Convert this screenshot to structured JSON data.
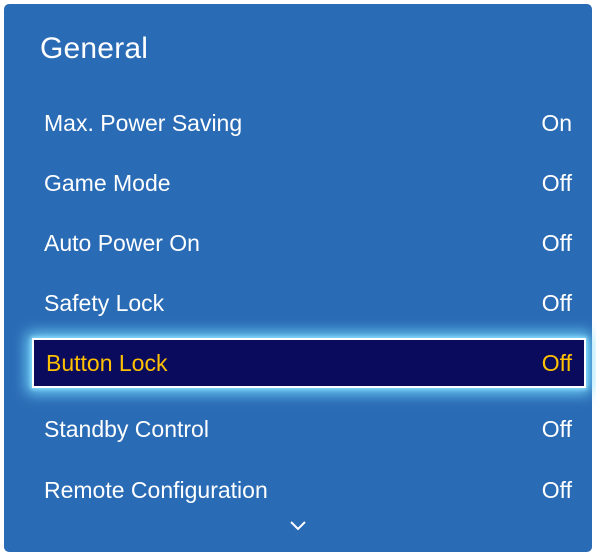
{
  "menu": {
    "title": "General",
    "items": [
      {
        "label": "Max. Power Saving",
        "value": "On",
        "selected": false
      },
      {
        "label": "Game Mode",
        "value": "Off",
        "selected": false
      },
      {
        "label": "Auto Power On",
        "value": "Off",
        "selected": false
      },
      {
        "label": "Safety Lock",
        "value": "Off",
        "selected": false
      },
      {
        "label": "Button Lock",
        "value": "Off",
        "selected": true
      },
      {
        "label": "Standby Control",
        "value": "Off",
        "selected": false
      },
      {
        "label": "Remote Configuration",
        "value": "Off",
        "selected": false
      }
    ],
    "scroll_icon": "chevron-down-icon"
  },
  "colors": {
    "panel_background": "#2a6bb5",
    "text": "#ffffff",
    "selected_background": "#0b0b5e",
    "selected_text": "#ffc000",
    "selected_glow": "#78dcff"
  }
}
